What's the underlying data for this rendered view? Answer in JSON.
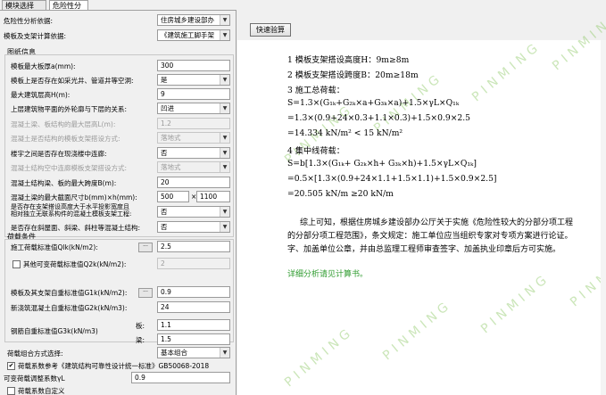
{
  "tabs": [
    "模块选择",
    "危险性分析"
  ],
  "left": {
    "basis_label": "危险性分析依据:",
    "basis_value": "住房城乡建设部办",
    "spec_label": "模板及支架计算依据:",
    "spec_value": "《建筑施工脚手架",
    "drawing_title": "图纸信息",
    "drawing_rows": [
      {
        "label": "模板最大板厚a(mm):",
        "value": "300",
        "kind": "input",
        "disabled": false
      },
      {
        "label": "模板上是否存在如采光井、管道井等空洞:",
        "value": "是",
        "kind": "select",
        "disabled": false
      },
      {
        "label": "最大建筑层高H(m):",
        "value": "9",
        "kind": "input",
        "disabled": false
      },
      {
        "label": "上层建筑物平面的外轮廓与下层的关系:",
        "value": "凹进",
        "kind": "select",
        "disabled": false
      },
      {
        "label": "混凝土梁、板结构的最大层高L(m):",
        "value": "1.2",
        "kind": "input",
        "disabled": true
      },
      {
        "label": "混凝土是否结构的模板支架搭设方式:",
        "value": "落地式",
        "kind": "select",
        "disabled": true
      },
      {
        "label": "楼宇之间是否存在现浇楼中连廊:",
        "value": "否",
        "kind": "select",
        "disabled": false
      },
      {
        "label": "混凝土结构空中连廊模板支架搭设方式:",
        "value": "落地式",
        "kind": "select",
        "disabled": true
      },
      {
        "label": "混凝土结构梁、板的最大跨度B(m):",
        "value": "20",
        "kind": "input",
        "disabled": false
      },
      {
        "label": "混凝土梁的最大截面尺寸b(mm)×h(mm):",
        "value": "500",
        "value2": "1100",
        "kind": "pair",
        "disabled": false
      },
      {
        "label": "是否存在支架搭设高度大于水平投影宽度且\n相对独立无联系构件的混凝土模板支架工程:",
        "value": "否",
        "kind": "select",
        "disabled": false
      },
      {
        "label": "是否存在斜屋面、斜梁、斜柱等混凝土结构:",
        "value": "否",
        "kind": "select",
        "disabled": false
      }
    ],
    "load_title": "荷载条件",
    "construction_load_label": "施工荷载标准值Qlk(kN/m2):",
    "construction_load_value": "2.5",
    "other_load_label": "其他可变荷载标准值Q2k(kN/m2):",
    "other_load_value": "2",
    "formwork_weight_label": "模板及其支架自重标准值G1k(kN/m2):",
    "formwork_weight_value": "0.9",
    "concrete_weight_label": "新浇筑混凝土自重标准值G2k(kN/m3):",
    "concrete_weight_value": "24",
    "rebar_weight_label": "钢筋自重标准值G3k(kN/m3)",
    "rebar_board_label": "板:",
    "rebar_board_value": "1.1",
    "rebar_beam_label": "梁:",
    "rebar_beam_value": "1.5",
    "combo_label": "荷载组合方式选择:",
    "combo_value": "基本组合",
    "factor_ref_label": "荷载系数参考《建筑结构可靠性设计统一标准》GB50068-2018",
    "factor_ref_checked": true,
    "variable_factor_label": "可变荷载调整系数γL",
    "variable_factor_value": "0.9",
    "custom_factor_label": "荷载系数自定义",
    "custom_factor_checked": false
  },
  "right": {
    "calc_button": "快速验算",
    "lines": [
      "1 模板支架搭设高度H：9m≥8m",
      "2 模板支架搭设跨度B：20m≥18m",
      "3 施工总荷载：",
      "S=1.3×(G₁ₖ+G₂ₖ×a+G₃ₖ×a)+1.5×γL×Q₁ₖ",
      "=1.3×(0.9+24×0.3+1.1×0.3)+1.5×0.9×2.5",
      "=14.334 kN/m² < 15 kN/m²",
      "4 集中线荷载：",
      "S=b[1.3×(G₁ₖ+ G₂ₖ×h+ G₃ₖ×h)+1.5×γL×Q₁ₖ]",
      "=0.5×[1.3×(0.9+24×1.1+1.5×1.1)+1.5×0.9×2.5]",
      "=20.505 kN/m ≥20 kN/m"
    ],
    "conclusion": [
      "综上可知，根据住房城乡建设部办公厅关于实施《危险性较大的分部分项工程",
      "的分部分项工程范围》，条文规定：施工单位应当组织专家对专项方案进行论证。",
      "字、加盖单位公章，并由总监理工程师审查签字、加盖执业印章后方可实施。"
    ],
    "link": "详细分析请见计算书。",
    "watermark": "PINMING"
  }
}
